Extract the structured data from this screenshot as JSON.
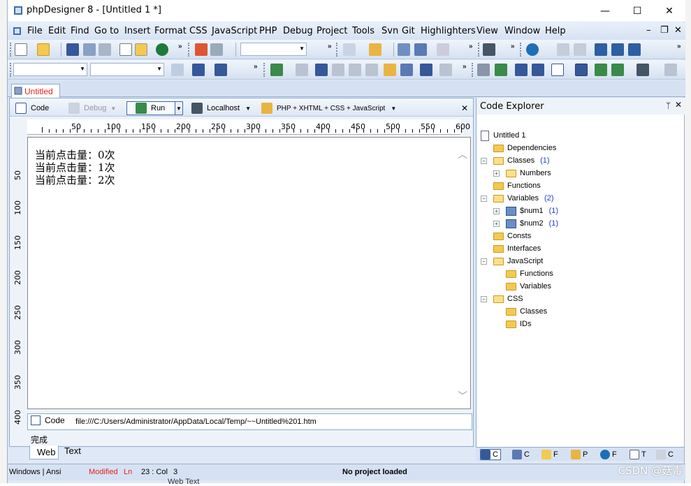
{
  "window": {
    "title": "phpDesigner 8 - [Untitled 1 *]",
    "minimize": "—",
    "maximize": "☐",
    "close": "✕"
  },
  "menu": {
    "items": [
      "File",
      "Edit",
      "Find",
      "Go to",
      "Insert",
      "Format",
      "CSS",
      "JavaScript",
      "PHP",
      "Debug",
      "Project",
      "Tools",
      "Svn",
      "Git",
      "Highlighters",
      "View",
      "Window",
      "Help"
    ],
    "mdi_minimize": "–",
    "mdi_restore": "❐",
    "mdi_close": "✕"
  },
  "document_tab": {
    "label": "Untitled 1"
  },
  "editor_toolbar": {
    "code": "Code",
    "debug": "Debug",
    "run": "Run",
    "localhost": "Localhost",
    "doctype": "PHP + XHTML + CSS + JavaScript",
    "close": "✕"
  },
  "ruler": {
    "labels": [
      "50",
      "100",
      "150",
      "200",
      "250",
      "300",
      "350",
      "400",
      "450",
      "500",
      "550",
      "600"
    ],
    "vlabels": [
      "50",
      "100",
      "150",
      "200",
      "250",
      "300",
      "350",
      "400"
    ]
  },
  "web_view": {
    "lines": [
      "当前点击量：0次",
      "当前点击量：1次",
      "当前点击量：2次"
    ]
  },
  "url_bar": {
    "code_label": "Code",
    "url": "file:///C:/Users/Administrator/AppData/Local/Temp/~~Untitled%201.htm"
  },
  "status_done": "完成",
  "bottom_tabs": {
    "web": "Web",
    "text": "Text"
  },
  "explorer": {
    "title": "Code Explorer",
    "pin": "ᛘ",
    "close": "✕",
    "tree": {
      "root": "Untitled 1",
      "dependencies": "Dependencies",
      "classes": "Classes",
      "classes_count": "(1)",
      "numbers": "Numbers",
      "functions": "Functions",
      "variables": "Variables",
      "variables_count": "(2)",
      "num1": "$num1",
      "num1_count": "(1)",
      "num2": "$num2",
      "num2_count": "(1)",
      "consts": "Consts",
      "interfaces": "Interfaces",
      "javascript": "JavaScript",
      "js_functions": "Functions",
      "js_variables": "Variables",
      "css": "CSS",
      "css_classes": "Classes",
      "css_ids": "IDs"
    },
    "tabs": [
      "C",
      "C",
      "F",
      "P",
      "F",
      "T",
      "C"
    ]
  },
  "statusbar": {
    "encoding": "Windows | Ansi",
    "modified": "Modified",
    "ln": "Ln",
    "position": "23 : Col",
    "col": "3",
    "project": "No project loaded"
  },
  "watermark": "CSDN @菇毒",
  "below_strip": "Web    Text",
  "colors": {
    "frame": "#dfe8f6",
    "accent": "#3d6ea7",
    "modified": "#e2231a",
    "count": "#1e40c8"
  }
}
